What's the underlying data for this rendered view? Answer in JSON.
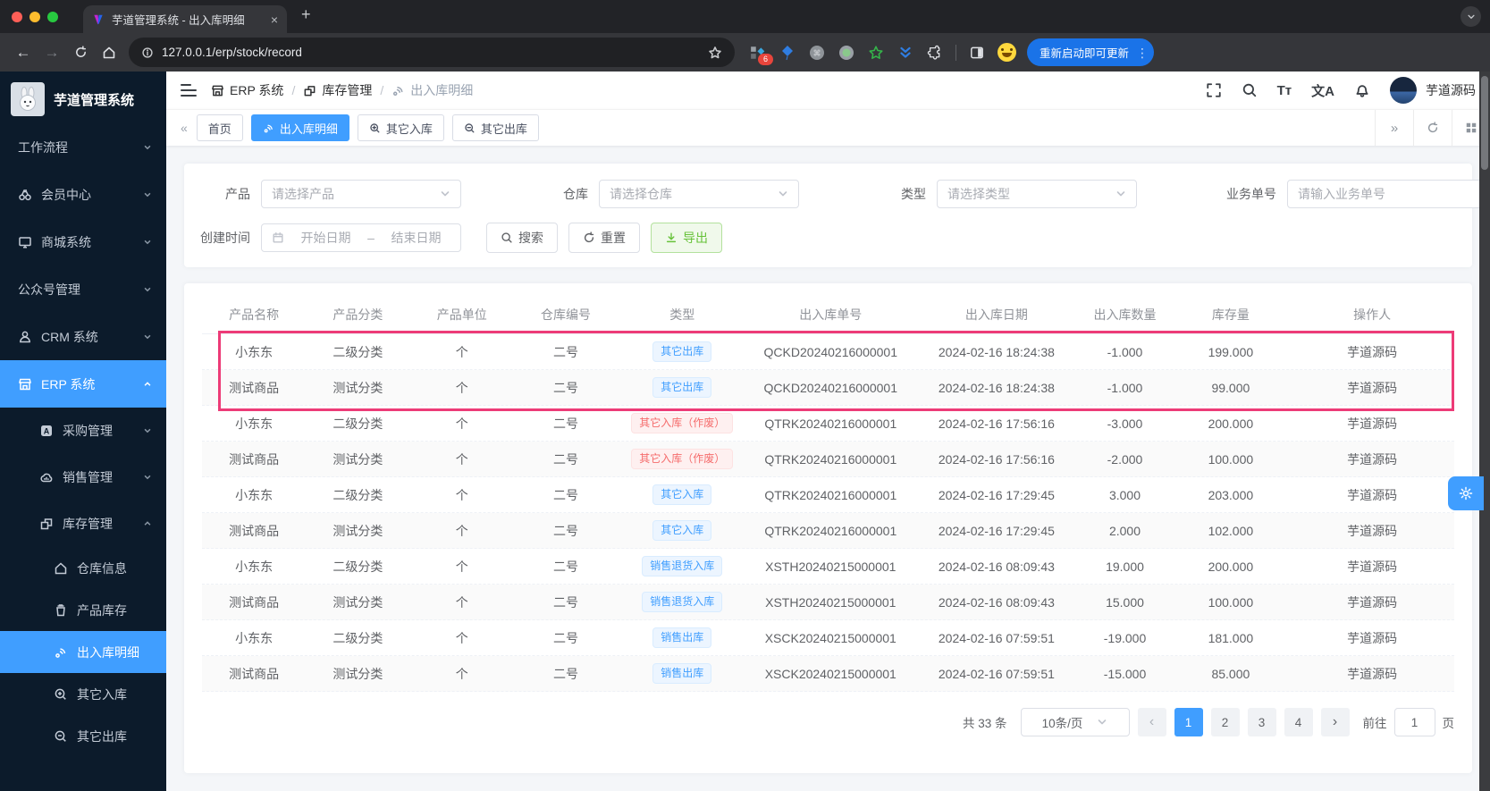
{
  "browser": {
    "tab_title": "芋道管理系统 - 出入库明细",
    "close_tab": "×",
    "new_tab": "+",
    "url": "127.0.0.1/erp/stock/record",
    "extension_badge": "6",
    "update_button": "重新启动即可更新"
  },
  "sidebar": {
    "app_title": "芋道管理系统",
    "items": [
      {
        "id": "workflow",
        "label": "工作流程",
        "level": 1,
        "icon": null,
        "chevron": "down",
        "active": false
      },
      {
        "id": "member",
        "label": "会员中心",
        "level": 1,
        "icon": "member",
        "chevron": "down",
        "active": false
      },
      {
        "id": "mall",
        "label": "商城系统",
        "level": 1,
        "icon": "monitor",
        "chevron": "down",
        "active": false
      },
      {
        "id": "mp",
        "label": "公众号管理",
        "level": 1,
        "icon": null,
        "chevron": "down",
        "active": false
      },
      {
        "id": "crm",
        "label": "CRM 系统",
        "level": 1,
        "icon": "person",
        "chevron": "down",
        "active": false
      },
      {
        "id": "erp",
        "label": "ERP 系统",
        "level": 1,
        "icon": "store",
        "chevron": "up",
        "active": true
      },
      {
        "id": "purchase",
        "label": "采购管理",
        "level": 2,
        "icon": "lettera",
        "chevron": "down",
        "active": false
      },
      {
        "id": "sales",
        "label": "销售管理",
        "level": 2,
        "icon": "cloud",
        "chevron": "down",
        "active": false
      },
      {
        "id": "stock",
        "label": "库存管理",
        "level": 2,
        "icon": "boxes",
        "chevron": "up",
        "active": false
      },
      {
        "id": "warehouse-info",
        "label": "仓库信息",
        "level": 3,
        "icon": "home",
        "chevron": null,
        "active": false
      },
      {
        "id": "product-stock",
        "label": "产品库存",
        "level": 3,
        "icon": "cup",
        "chevron": null,
        "active": false
      },
      {
        "id": "stock-record",
        "label": "出入库明细",
        "level": 3,
        "icon": "signal",
        "chevron": null,
        "active": true
      },
      {
        "id": "other-in",
        "label": "其它入库",
        "level": 3,
        "icon": "cplus",
        "chevron": null,
        "active": false
      },
      {
        "id": "other-out",
        "label": "其它出库",
        "level": 3,
        "icon": "cminus",
        "chevron": null,
        "active": false
      }
    ]
  },
  "header": {
    "breadcrumb": [
      {
        "icon": "store",
        "label": "ERP 系统"
      },
      {
        "icon": "boxes",
        "label": "库存管理"
      },
      {
        "icon": "signal",
        "label": "出入库明细"
      }
    ],
    "separator": "/",
    "font_size_icon": "Tт",
    "translate_icon": "文A",
    "username": "芋道源码"
  },
  "tags": {
    "left_arrow": "«",
    "right_arrow": "»",
    "items": [
      {
        "label": "首页",
        "icon": null,
        "active": false
      },
      {
        "label": "出入库明细",
        "icon": "signal",
        "active": true
      },
      {
        "label": "其它入库",
        "icon": "cplus",
        "active": false
      },
      {
        "label": "其它出库",
        "icon": "cminus",
        "active": false
      }
    ]
  },
  "filters": {
    "product_label": "产品",
    "product_placeholder": "请选择产品",
    "warehouse_label": "仓库",
    "warehouse_placeholder": "请选择仓库",
    "type_label": "类型",
    "type_placeholder": "请选择类型",
    "bizno_label": "业务单号",
    "bizno_placeholder": "请输入业务单号",
    "time_label": "创建时间",
    "time_start": "开始日期",
    "time_sep": "–",
    "time_end": "结束日期",
    "search_label": "搜索",
    "reset_label": "重置",
    "export_label": "导出"
  },
  "table": {
    "headers": [
      "产品名称",
      "产品分类",
      "产品单位",
      "仓库编号",
      "类型",
      "出入库单号",
      "出入库日期",
      "出入库数量",
      "库存量",
      "操作人"
    ],
    "rows": [
      {
        "name": "小东东",
        "category": "二级分类",
        "unit": "个",
        "warehouse": "二号",
        "type": "其它出库",
        "type_color": "blue",
        "order_no": "QCKD20240216000001",
        "date": "2024-02-16 18:24:38",
        "qty": "-1.000",
        "stock": "199.000",
        "operator": "芋道源码",
        "striped": false
      },
      {
        "name": "测试商品",
        "category": "测试分类",
        "unit": "个",
        "warehouse": "二号",
        "type": "其它出库",
        "type_color": "blue",
        "order_no": "QCKD20240216000001",
        "date": "2024-02-16 18:24:38",
        "qty": "-1.000",
        "stock": "99.000",
        "operator": "芋道源码",
        "striped": true
      },
      {
        "name": "小东东",
        "category": "二级分类",
        "unit": "个",
        "warehouse": "二号",
        "type": "其它入库（作废）",
        "type_color": "red",
        "order_no": "QTRK20240216000001",
        "date": "2024-02-16 17:56:16",
        "qty": "-3.000",
        "stock": "200.000",
        "operator": "芋道源码",
        "striped": false
      },
      {
        "name": "测试商品",
        "category": "测试分类",
        "unit": "个",
        "warehouse": "二号",
        "type": "其它入库（作废）",
        "type_color": "red",
        "order_no": "QTRK20240216000001",
        "date": "2024-02-16 17:56:16",
        "qty": "-2.000",
        "stock": "100.000",
        "operator": "芋道源码",
        "striped": true
      },
      {
        "name": "小东东",
        "category": "二级分类",
        "unit": "个",
        "warehouse": "二号",
        "type": "其它入库",
        "type_color": "blue",
        "order_no": "QTRK20240216000001",
        "date": "2024-02-16 17:29:45",
        "qty": "3.000",
        "stock": "203.000",
        "operator": "芋道源码",
        "striped": false
      },
      {
        "name": "测试商品",
        "category": "测试分类",
        "unit": "个",
        "warehouse": "二号",
        "type": "其它入库",
        "type_color": "blue",
        "order_no": "QTRK20240216000001",
        "date": "2024-02-16 17:29:45",
        "qty": "2.000",
        "stock": "102.000",
        "operator": "芋道源码",
        "striped": true
      },
      {
        "name": "小东东",
        "category": "二级分类",
        "unit": "个",
        "warehouse": "二号",
        "type": "销售退货入库",
        "type_color": "blue",
        "order_no": "XSTH20240215000001",
        "date": "2024-02-16 08:09:43",
        "qty": "19.000",
        "stock": "200.000",
        "operator": "芋道源码",
        "striped": false
      },
      {
        "name": "测试商品",
        "category": "测试分类",
        "unit": "个",
        "warehouse": "二号",
        "type": "销售退货入库",
        "type_color": "blue",
        "order_no": "XSTH20240215000001",
        "date": "2024-02-16 08:09:43",
        "qty": "15.000",
        "stock": "100.000",
        "operator": "芋道源码",
        "striped": true
      },
      {
        "name": "小东东",
        "category": "二级分类",
        "unit": "个",
        "warehouse": "二号",
        "type": "销售出库",
        "type_color": "blue",
        "order_no": "XSCK20240215000001",
        "date": "2024-02-16 07:59:51",
        "qty": "-19.000",
        "stock": "181.000",
        "operator": "芋道源码",
        "striped": false
      },
      {
        "name": "测试商品",
        "category": "测试分类",
        "unit": "个",
        "warehouse": "二号",
        "type": "销售出库",
        "type_color": "blue",
        "order_no": "XSCK20240215000001",
        "date": "2024-02-16 07:59:51",
        "qty": "-15.000",
        "stock": "85.000",
        "operator": "芋道源码",
        "striped": true
      }
    ]
  },
  "pagination": {
    "total": "共 33 条",
    "page_size": "10条/页",
    "prev": "‹",
    "next": "›",
    "pages": [
      "1",
      "2",
      "3",
      "4"
    ],
    "active_page": "1",
    "goto_label": "前往",
    "goto_value": "1",
    "page_suffix": "页"
  },
  "colors": {
    "accent_blue": "#409eff",
    "highlight_pink": "#ed3b77",
    "export_green": "#67c23a",
    "badge_red": "#f56c6c"
  }
}
